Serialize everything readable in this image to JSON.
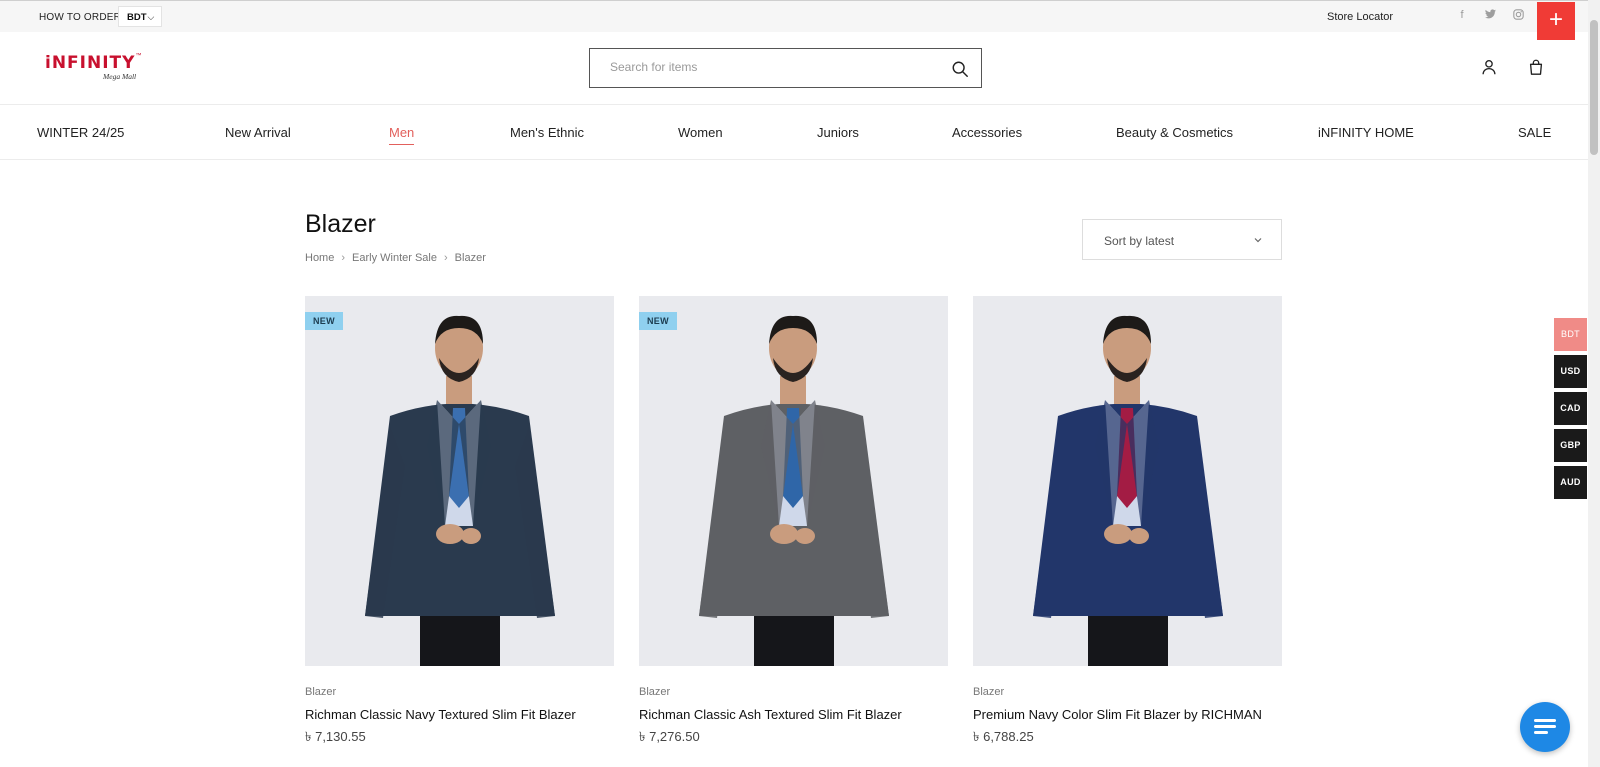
{
  "topbar": {
    "how_to_order": "HOW TO ORDER",
    "currency": "BDT",
    "store_locator": "Store Locator",
    "social": [
      "facebook-icon",
      "twitter-icon",
      "instagram-icon"
    ],
    "plus": "+"
  },
  "header": {
    "logo_text": "iNFINITY",
    "logo_tm": "™",
    "logo_sub": "Mega Mall",
    "search_placeholder": "Search for items"
  },
  "nav": {
    "items": [
      "WINTER 24/25",
      "New Arrival",
      "Men",
      "Men's Ethnic",
      "Women",
      "Juniors",
      "Accessories",
      "Beauty & Cosmetics",
      "iNFINITY HOME",
      "SALE"
    ],
    "active_index": 2
  },
  "page": {
    "title": "Blazer",
    "breadcrumbs": [
      "Home",
      "Early Winter Sale",
      "Blazer"
    ],
    "sort_label": "Sort by latest"
  },
  "products": [
    {
      "badge": "NEW",
      "category": "Blazer",
      "name": "Richman Classic Navy Textured Slim Fit Blazer",
      "price": "৳ 7,130.55",
      "jacket_color": "#2a3a4e",
      "tie_color": "#3b6fb0"
    },
    {
      "badge": "NEW",
      "category": "Blazer",
      "name": "Richman Classic Ash Textured Slim Fit Blazer",
      "price": "৳ 7,276.50",
      "jacket_color": "#5e6064",
      "tie_color": "#2f66a8"
    },
    {
      "badge": "",
      "category": "Blazer",
      "name": "Premium Navy Color Slim Fit Blazer by RICHMAN",
      "price": "৳ 6,788.25",
      "jacket_color": "#22366a",
      "tie_color": "#a31c44"
    }
  ],
  "currency_rail": [
    "BDT",
    "USD",
    "CAD",
    "GBP",
    "AUD"
  ],
  "colors": {
    "accent": "#e2605c",
    "plus_button": "#f03b36",
    "chat_button": "#1e88e5",
    "badge": "#8fd0ef"
  }
}
